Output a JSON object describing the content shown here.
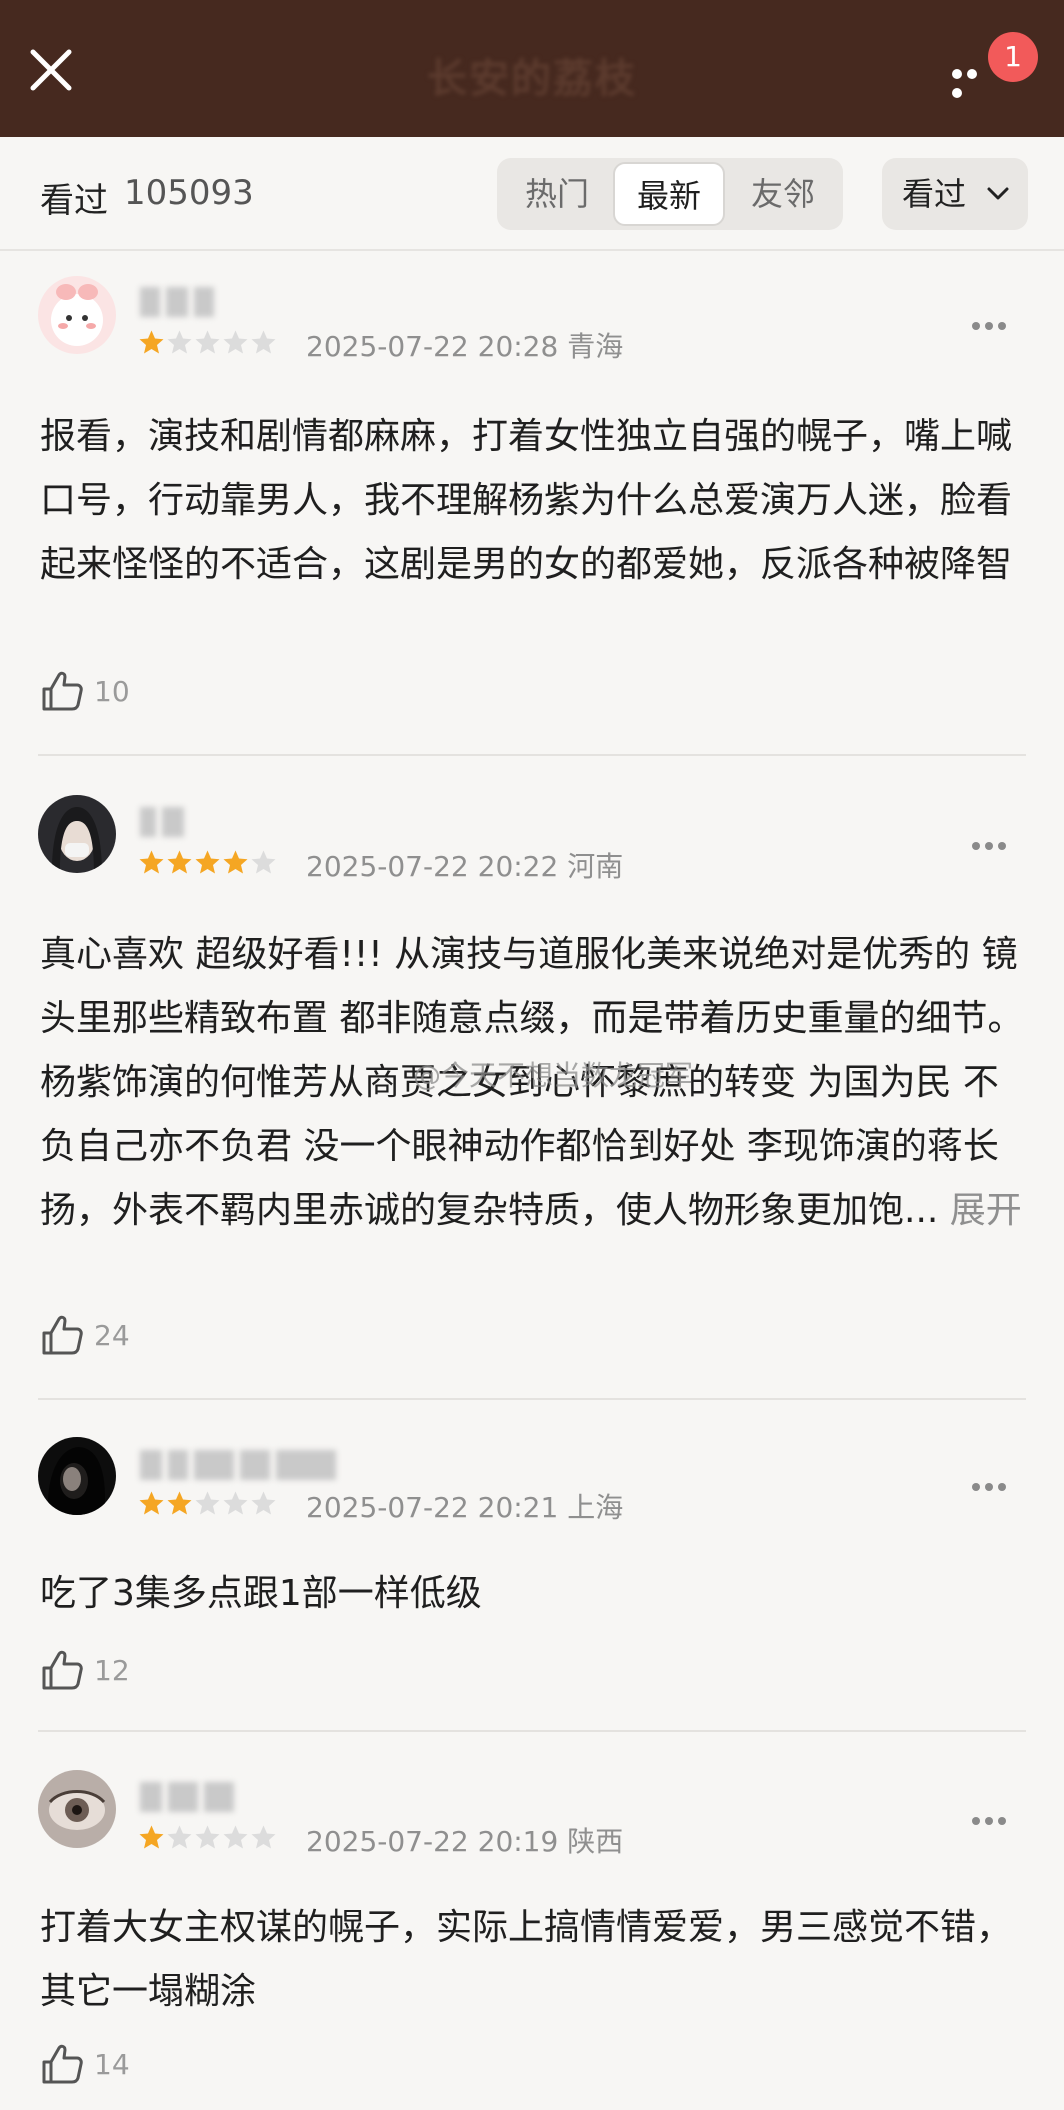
{
  "header": {
    "title": "长安的荔枝",
    "notification_count": "1"
  },
  "filter": {
    "watched_label": "看过",
    "watched_count": "105093",
    "tabs": [
      "热门",
      "最新",
      "友邻"
    ],
    "active_tab": "最新",
    "dropdown_label": "看过"
  },
  "colors": {
    "header_bg": "#46291f",
    "star_filled": "#f5a623",
    "star_empty": "#dcdcdc",
    "badge": "#f25a5a"
  },
  "reviews": [
    {
      "rating": 1,
      "date": "2025-07-22 20:28",
      "location": "青海",
      "text": "报看，演技和剧情都麻麻，打着女性独立自强的幌子，嘴上喊口号，行动靠男人，我不理解杨紫为什么总爱演万人迷，脸看起来怪怪的不适合，这剧是男的女的都爱她，反派各种被降智",
      "likes": "10"
    },
    {
      "rating": 4,
      "date": "2025-07-22 20:22",
      "location": "河南",
      "text": "真心喜欢 超级好看!!! 从演技与道服化美来说绝对是优秀的 镜头里那些精致布置 都非随意点缀，而是带着历史重量的细节。杨紫饰演的何惟芳从商贾之女到心怀黎庶的转变 为国为民 不负自己亦不负君 没一个眼神动作都恰到好处 李现饰演的蒋长扬，外表不羁内里赤诚的复杂特质，使人物形象更加饱...",
      "expand": "展开",
      "likes": "24"
    },
    {
      "rating": 2,
      "date": "2025-07-22 20:21",
      "location": "上海",
      "text": "吃了3集多点跟1部一样低级",
      "likes": "12"
    },
    {
      "rating": 1,
      "date": "2025-07-22 20:19",
      "location": "陕西",
      "text": "打着大女主权谋的幌子，实际上搞情情爱爱，男三感觉不错，其它一塌糊涂",
      "likes": "14"
    }
  ],
  "watermark": "@今天不想当数龙冠军"
}
